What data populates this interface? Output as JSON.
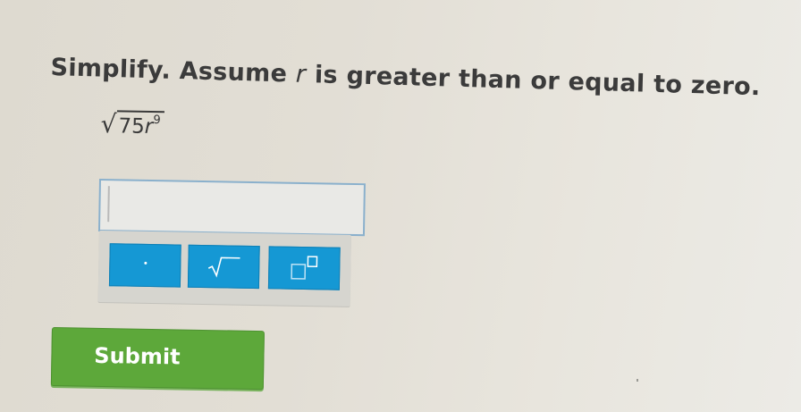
{
  "question": {
    "prompt_before": "Simplify. Assume ",
    "prompt_var": "r",
    "prompt_after": " is greater than or equal to zero.",
    "expression": {
      "coefficient": "75",
      "variable": "r",
      "exponent": "9"
    }
  },
  "answer": {
    "value": "",
    "placeholder": ""
  },
  "toolbar": {
    "buttons": [
      {
        "name": "multiply-dot",
        "icon": "dot-icon"
      },
      {
        "name": "square-root",
        "icon": "sqrt-icon"
      },
      {
        "name": "exponent",
        "icon": "exponent-icon"
      }
    ]
  },
  "submit": {
    "label": "Submit"
  },
  "colors": {
    "tool_button": "#1598d4",
    "submit_button": "#5da83a",
    "input_border": "#8ab0cc",
    "background": "#e2ded5"
  }
}
